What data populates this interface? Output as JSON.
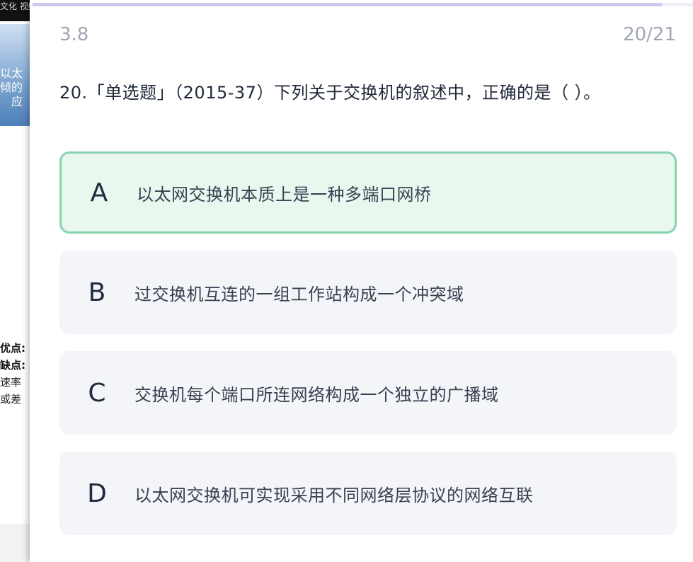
{
  "background": {
    "top_text": "文化 视频",
    "video_text_lines": [
      "以太",
      "倾的",
      "应"
    ],
    "side_lines": [
      "优点:",
      "缺点:",
      "速率",
      "或差"
    ]
  },
  "header": {
    "section": "3.8",
    "counter": "20/21",
    "progress": 0.9524
  },
  "question": {
    "text": "20.「单选题」（2015-37）下列关于交换机的叙述中，正确的是（ ）。"
  },
  "options": [
    {
      "letter": "A",
      "text": "以太网交换机本质上是一种多端口网桥",
      "selected": true
    },
    {
      "letter": "B",
      "text": "过交换机互连的一组工作站构成一个冲突域",
      "selected": false
    },
    {
      "letter": "C",
      "text": "交换机每个端口所连网络构成一个独立的广播域",
      "selected": false
    },
    {
      "letter": "D",
      "text": "以太网交换机可实现采用不同网络层协议的网络互联",
      "selected": false
    }
  ],
  "colors": {
    "selected_border": "#86d3ad",
    "selected_bg": "#eaf7ef",
    "option_bg": "#f4f5f8",
    "progress_fill": "#cfc8ee"
  }
}
